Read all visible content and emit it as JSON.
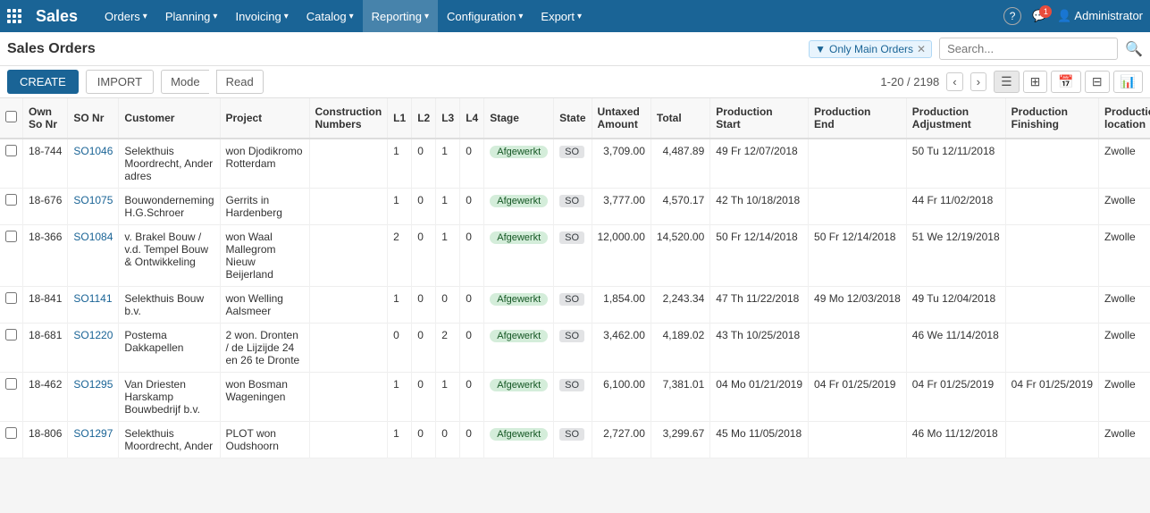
{
  "app": {
    "name": "Sales",
    "icon": "grid-icon"
  },
  "nav": {
    "items": [
      {
        "label": "Orders",
        "hasDropdown": true
      },
      {
        "label": "Planning",
        "hasDropdown": true
      },
      {
        "label": "Invoicing",
        "hasDropdown": true
      },
      {
        "label": "Catalog",
        "hasDropdown": true
      },
      {
        "label": "Reporting",
        "hasDropdown": true,
        "active": true
      },
      {
        "label": "Configuration",
        "hasDropdown": true
      },
      {
        "label": "Export",
        "hasDropdown": true
      }
    ]
  },
  "topbar_right": {
    "help_icon": "?",
    "chat_badge": "1",
    "user": "Administrator"
  },
  "page": {
    "title": "Sales Orders"
  },
  "toolbar": {
    "create_label": "CREATE",
    "import_label": "IMPORT",
    "mode_label": "Mode",
    "read_label": "Read"
  },
  "filter": {
    "label": "Only Main Orders",
    "icon": "funnel"
  },
  "search": {
    "placeholder": "Search..."
  },
  "pagination": {
    "info": "1-20 / 2198"
  },
  "columns": [
    {
      "key": "checkbox",
      "label": ""
    },
    {
      "key": "own_so_nr",
      "label": "Own So Nr"
    },
    {
      "key": "so_nr",
      "label": "SO Nr"
    },
    {
      "key": "customer",
      "label": "Customer"
    },
    {
      "key": "project",
      "label": "Project"
    },
    {
      "key": "construction_numbers",
      "label": "Construction Numbers"
    },
    {
      "key": "l1",
      "label": "L1"
    },
    {
      "key": "l2",
      "label": "L2"
    },
    {
      "key": "l3",
      "label": "L3"
    },
    {
      "key": "l4",
      "label": "L4"
    },
    {
      "key": "stage",
      "label": "Stage"
    },
    {
      "key": "state",
      "label": "State"
    },
    {
      "key": "untaxed_amount",
      "label": "Untaxed Amount"
    },
    {
      "key": "total",
      "label": "Total"
    },
    {
      "key": "production_start",
      "label": "Production Start"
    },
    {
      "key": "production_end",
      "label": "Production End"
    },
    {
      "key": "production_adjustment",
      "label": "Production Adjustment"
    },
    {
      "key": "production_finishing",
      "label": "Production Finishing"
    },
    {
      "key": "production_location",
      "label": "Production location"
    }
  ],
  "rows": [
    {
      "own_so_nr": "18-744",
      "so_nr": "SO1046",
      "customer": "Selekthuis Moordrecht, Ander adres",
      "project": "won Djodikromo Rotterdam",
      "construction_numbers": "",
      "l1": "1",
      "l2": "0",
      "l3": "1",
      "l4": "0",
      "stage": "Afgewerkt",
      "state": "SO",
      "untaxed_amount": "3,709.00",
      "total": "4,487.89",
      "production_start": "49 Fr 12/07/2018",
      "production_end": "",
      "production_adjustment": "50 Tu 12/11/2018",
      "production_finishing": "",
      "production_location": "Zwolle"
    },
    {
      "own_so_nr": "18-676",
      "so_nr": "SO1075",
      "customer": "Bouwonderneming H.G.Schroer",
      "project": "Gerrits in Hardenberg",
      "construction_numbers": "",
      "l1": "1",
      "l2": "0",
      "l3": "1",
      "l4": "0",
      "stage": "Afgewerkt",
      "state": "SO",
      "untaxed_amount": "3,777.00",
      "total": "4,570.17",
      "production_start": "42 Th 10/18/2018",
      "production_end": "",
      "production_adjustment": "44 Fr 11/02/2018",
      "production_finishing": "",
      "production_location": "Zwolle"
    },
    {
      "own_so_nr": "18-366",
      "so_nr": "SO1084",
      "customer": "v. Brakel Bouw / v.d. Tempel Bouw & Ontwikkeling",
      "project": "won Waal Mallegrom Nieuw Beijerland",
      "construction_numbers": "",
      "l1": "2",
      "l2": "0",
      "l3": "1",
      "l4": "0",
      "stage": "Afgewerkt",
      "state": "SO",
      "untaxed_amount": "12,000.00",
      "total": "14,520.00",
      "production_start": "50 Fr 12/14/2018",
      "production_end": "50 Fr 12/14/2018",
      "production_adjustment": "51 We 12/19/2018",
      "production_finishing": "",
      "production_location": "Zwolle"
    },
    {
      "own_so_nr": "18-841",
      "so_nr": "SO1141",
      "customer": "Selekthuis Bouw b.v.",
      "project": "won Welling Aalsmeer",
      "construction_numbers": "",
      "l1": "1",
      "l2": "0",
      "l3": "0",
      "l4": "0",
      "stage": "Afgewerkt",
      "state": "SO",
      "untaxed_amount": "1,854.00",
      "total": "2,243.34",
      "production_start": "47 Th 11/22/2018",
      "production_end": "49 Mo 12/03/2018",
      "production_adjustment": "49 Tu 12/04/2018",
      "production_finishing": "",
      "production_location": "Zwolle"
    },
    {
      "own_so_nr": "18-681",
      "so_nr": "SO1220",
      "customer": "Postema Dakkapellen",
      "project": "2 won. Dronten / de Lijzijde 24 en 26 te Dronte",
      "construction_numbers": "",
      "l1": "0",
      "l2": "0",
      "l3": "2",
      "l4": "0",
      "stage": "Afgewerkt",
      "state": "SO",
      "untaxed_amount": "3,462.00",
      "total": "4,189.02",
      "production_start": "43 Th 10/25/2018",
      "production_end": "",
      "production_adjustment": "46 We 11/14/2018",
      "production_finishing": "",
      "production_location": "Zwolle"
    },
    {
      "own_so_nr": "18-462",
      "so_nr": "SO1295",
      "customer": "Van Driesten Harskamp Bouwbedrijf b.v.",
      "project": "won Bosman Wageningen",
      "construction_numbers": "",
      "l1": "1",
      "l2": "0",
      "l3": "1",
      "l4": "0",
      "stage": "Afgewerkt",
      "state": "SO",
      "untaxed_amount": "6,100.00",
      "total": "7,381.01",
      "production_start": "04 Mo 01/21/2019",
      "production_end": "04 Fr 01/25/2019",
      "production_adjustment": "04 Fr 01/25/2019",
      "production_finishing": "04 Fr 01/25/2019",
      "production_location": "Zwolle"
    },
    {
      "own_so_nr": "18-806",
      "so_nr": "SO1297",
      "customer": "Selekthuis Moordrecht, Ander",
      "project": "PLOT won Oudshoorn",
      "construction_numbers": "",
      "l1": "1",
      "l2": "0",
      "l3": "0",
      "l4": "0",
      "stage": "Afgewerkt",
      "state": "SO",
      "untaxed_amount": "2,727.00",
      "total": "3,299.67",
      "production_start": "45 Mo 11/05/2018",
      "production_end": "",
      "production_adjustment": "46 Mo 11/12/2018",
      "production_finishing": "",
      "production_location": "Zwolle"
    }
  ]
}
